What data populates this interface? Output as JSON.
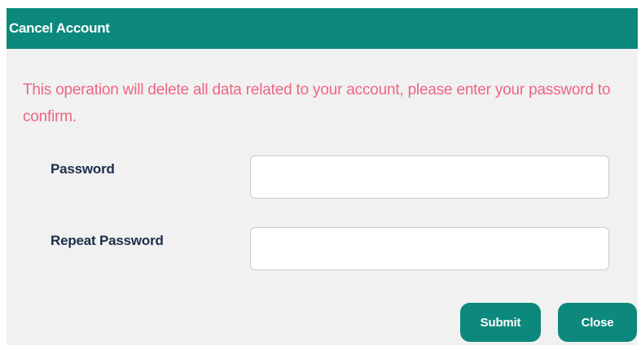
{
  "dialog": {
    "title": "Cancel Account",
    "warning": "This operation will delete all data related to your account, please enter your password to confirm.",
    "fields": {
      "password": {
        "label": "Password",
        "value": "",
        "placeholder": ""
      },
      "repeat_password": {
        "label": "Repeat Password",
        "value": "",
        "placeholder": ""
      }
    },
    "buttons": {
      "submit": "Submit",
      "close": "Close"
    }
  },
  "colors": {
    "header": "#0c887c",
    "warning_text": "#ec6783",
    "label_text": "#1c2e4a",
    "dialog_background": "#f1f1f1"
  }
}
